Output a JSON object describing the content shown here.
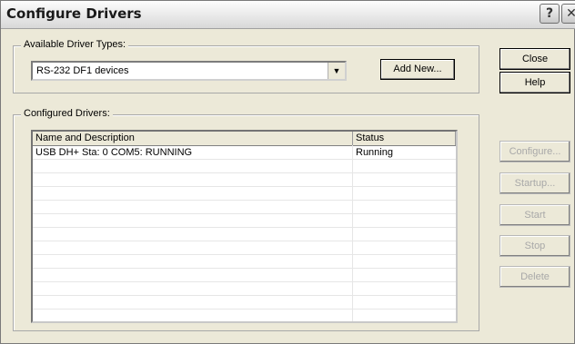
{
  "window": {
    "title": "Configure Drivers",
    "help_glyph": "?",
    "close_glyph": "✕"
  },
  "available": {
    "legend": "Available Driver Types:",
    "selected": "RS-232 DF1 devices",
    "add_new_label": "Add New..."
  },
  "configured": {
    "legend": "Configured Drivers:",
    "columns": [
      "Name and Description",
      "Status"
    ],
    "rows": [
      {
        "name": "USB DH+ Sta: 0 COM5: RUNNING",
        "status": "Running"
      }
    ]
  },
  "buttons": {
    "close": "Close",
    "help": "Help",
    "configure": "Configure...",
    "startup": "Startup...",
    "start": "Start",
    "stop": "Stop",
    "delete": "Delete"
  }
}
